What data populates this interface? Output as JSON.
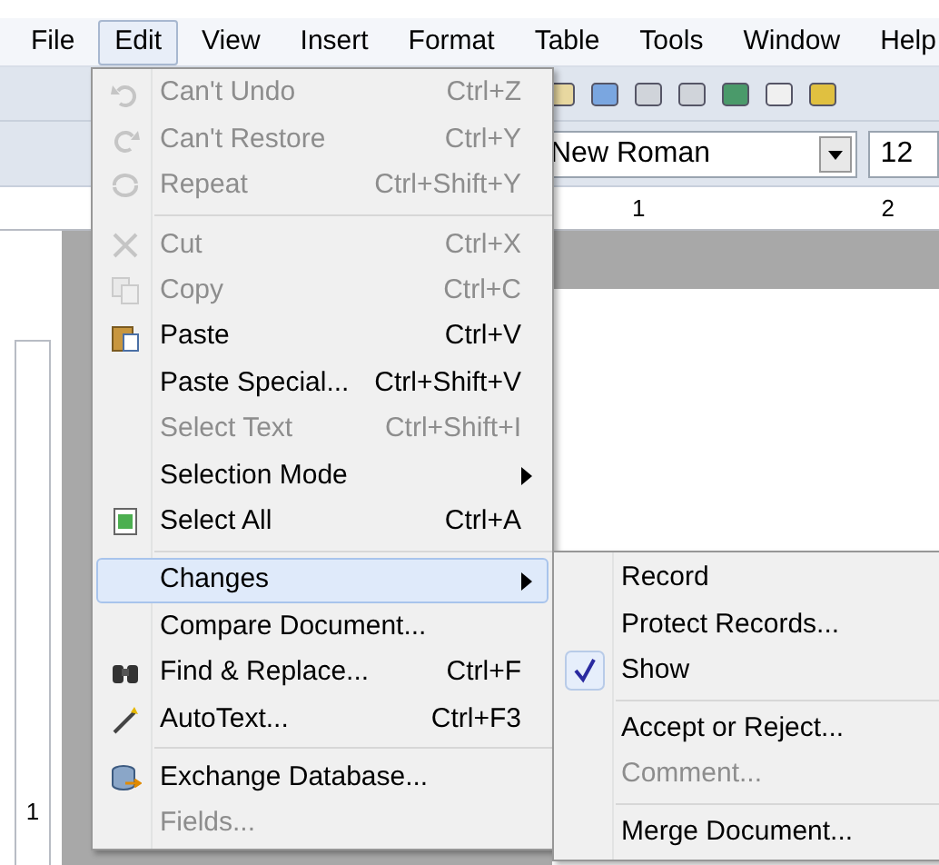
{
  "menubar": [
    {
      "label": "File",
      "selected": false
    },
    {
      "label": "Edit",
      "selected": true
    },
    {
      "label": "View",
      "selected": false
    },
    {
      "label": "Insert",
      "selected": false
    },
    {
      "label": "Format",
      "selected": false
    },
    {
      "label": "Table",
      "selected": false
    },
    {
      "label": "Tools",
      "selected": false
    },
    {
      "label": "Window",
      "selected": false
    },
    {
      "label": "Help",
      "selected": false
    }
  ],
  "toolbar": {
    "font_name": "New Roman",
    "font_size": "12"
  },
  "ruler": {
    "marks": [
      "1",
      "2"
    ]
  },
  "vertical_ruler": {
    "marks": [
      "1"
    ]
  },
  "edit_menu": [
    {
      "kind": "item",
      "label": "Can't Undo",
      "shortcut": "Ctrl+Z",
      "disabled": true,
      "selected": false
    },
    {
      "kind": "item",
      "label": "Can't Restore",
      "shortcut": "Ctrl+Y",
      "disabled": true,
      "selected": false
    },
    {
      "kind": "item",
      "label": "Repeat",
      "shortcut": "Ctrl+Shift+Y",
      "disabled": true,
      "selected": false
    },
    {
      "kind": "separator"
    },
    {
      "kind": "item",
      "label": "Cut",
      "shortcut": "Ctrl+X",
      "disabled": true,
      "selected": false
    },
    {
      "kind": "item",
      "label": "Copy",
      "shortcut": "Ctrl+C",
      "disabled": true,
      "selected": false
    },
    {
      "kind": "item",
      "label": "Paste",
      "shortcut": "Ctrl+V",
      "disabled": false,
      "selected": false
    },
    {
      "kind": "item",
      "label": "Paste Special...",
      "shortcut": "Ctrl+Shift+V",
      "disabled": false,
      "selected": false
    },
    {
      "kind": "item",
      "label": "Select Text",
      "shortcut": "Ctrl+Shift+I",
      "disabled": true,
      "selected": false
    },
    {
      "kind": "submenu",
      "label": "Selection Mode",
      "disabled": false,
      "selected": false
    },
    {
      "kind": "item",
      "label": "Select All",
      "shortcut": "Ctrl+A",
      "disabled": false,
      "selected": false
    },
    {
      "kind": "separator"
    },
    {
      "kind": "submenu",
      "label": "Changes",
      "disabled": false,
      "selected": true
    },
    {
      "kind": "item",
      "label": "Compare Document...",
      "disabled": false,
      "selected": false
    },
    {
      "kind": "item",
      "label": "Find & Replace...",
      "shortcut": "Ctrl+F",
      "disabled": false,
      "selected": false
    },
    {
      "kind": "item",
      "label": "AutoText...",
      "shortcut": "Ctrl+F3",
      "disabled": false,
      "selected": false
    },
    {
      "kind": "separator"
    },
    {
      "kind": "item",
      "label": "Exchange Database...",
      "disabled": false,
      "selected": false
    },
    {
      "kind": "item",
      "label": "Fields...",
      "disabled": true,
      "selected": false
    }
  ],
  "changes_submenu": [
    {
      "kind": "item",
      "label": "Record",
      "disabled": false,
      "checked": false
    },
    {
      "kind": "item",
      "label": "Protect Records...",
      "disabled": false,
      "checked": false
    },
    {
      "kind": "item",
      "label": "Show",
      "disabled": false,
      "checked": true
    },
    {
      "kind": "separator"
    },
    {
      "kind": "item",
      "label": "Accept or Reject...",
      "disabled": false,
      "checked": false
    },
    {
      "kind": "item",
      "label": "Comment...",
      "disabled": true,
      "checked": false
    },
    {
      "kind": "separator"
    },
    {
      "kind": "item",
      "label": "Merge Document...",
      "disabled": false,
      "checked": false
    }
  ]
}
